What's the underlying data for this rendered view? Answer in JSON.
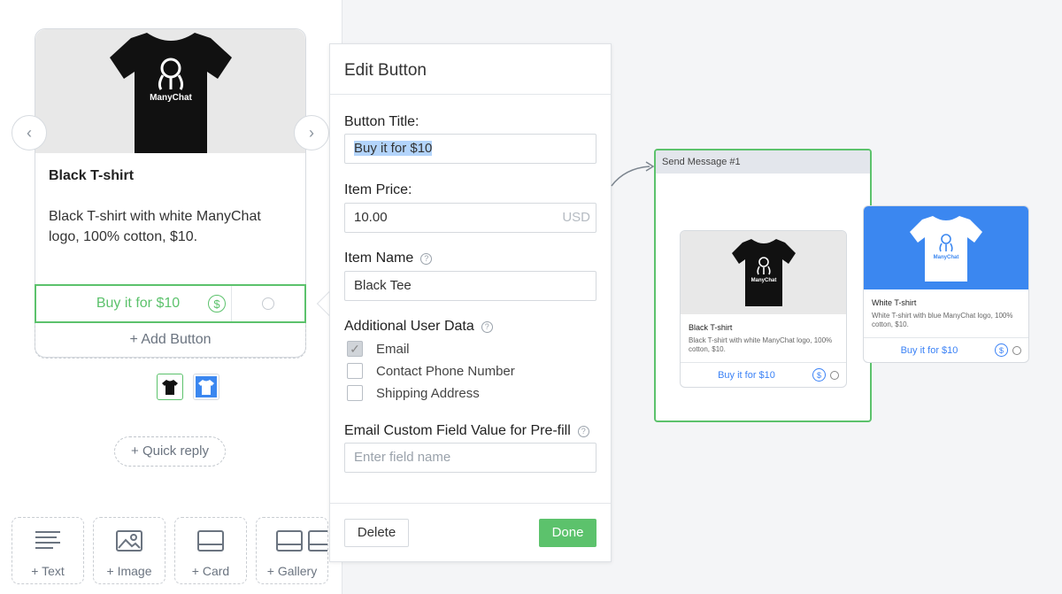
{
  "card": {
    "title": "Black T-shirt",
    "description": "Black T-shirt with white ManyChat logo, 100% cotton, $10.",
    "button_label": "Buy it for $10",
    "add_button_label": "+ Add Button",
    "shirt_logo_text": "ManyChat"
  },
  "quick_reply_label": "+ Quick reply",
  "toolbar": {
    "text_label": "+ Text",
    "image_label": "+ Image",
    "card_label": "+ Card",
    "gallery_label": "+ Gallery"
  },
  "edit_panel": {
    "header": "Edit Button",
    "button_title_label": "Button Title:",
    "button_title_value": "Buy it for $10",
    "item_price_label": "Item Price:",
    "item_price_value": "10.00",
    "currency": "USD",
    "item_name_label": "Item Name",
    "item_name_value": "Black Tee",
    "additional_data_label": "Additional User Data",
    "checkboxes": [
      {
        "label": "Email",
        "checked": true
      },
      {
        "label": "Contact Phone Number",
        "checked": false
      },
      {
        "label": "Shipping Address",
        "checked": false
      }
    ],
    "prefill_label": "Email Custom Field Value for Pre-fill",
    "prefill_placeholder": "Enter field name",
    "delete_label": "Delete",
    "done_label": "Done"
  },
  "node": {
    "header": "Send Message #1",
    "cards": [
      {
        "title": "Black T-shirt",
        "description": "Black T-shirt with white ManyChat logo, 100% cotton, $10.",
        "button_label": "Buy it for $10"
      },
      {
        "title": "White T-shirt",
        "description": "White T-shirt with blue ManyChat logo, 100% cotton, $10.",
        "button_label": "Buy it for $10"
      }
    ]
  },
  "colors": {
    "accent_green": "#5cc26c",
    "link_blue": "#3b82f6",
    "white_card_bg": "#3b87f0"
  },
  "icons": [
    "chevron-left-icon",
    "chevron-right-icon",
    "dollar-icon",
    "help-icon",
    "text-icon",
    "image-icon",
    "card-icon",
    "gallery-icon"
  ]
}
